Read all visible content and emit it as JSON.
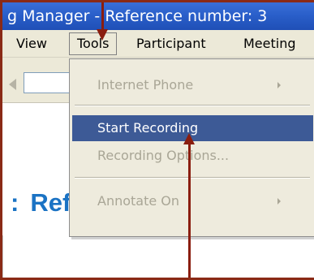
{
  "window": {
    "title": "g Manager - Reference number: 3",
    "border_color": "#8a2a16"
  },
  "menubar": {
    "items": [
      {
        "label": "View"
      },
      {
        "label": "Tools"
      },
      {
        "label": "Participant"
      },
      {
        "label": "Meeting"
      }
    ],
    "active": "Tools"
  },
  "tools_menu": {
    "items": [
      {
        "label": "Internet Phone",
        "enabled": false,
        "submenu": true
      },
      {
        "label": "Start Recording",
        "enabled": true,
        "highlighted": true
      },
      {
        "label": "Recording Options...",
        "enabled": false
      },
      {
        "label": "Annotate On",
        "enabled": false,
        "submenu": true
      }
    ]
  },
  "content": {
    "heading_prefix": ":",
    "heading": "Reference number"
  },
  "colors": {
    "title_bar": "#2a5fca",
    "menu_highlight": "#3d5a96",
    "disabled_text": "#a9a696",
    "heading_text": "#1b73c4",
    "annotation_arrow": "#8a1d0f"
  }
}
